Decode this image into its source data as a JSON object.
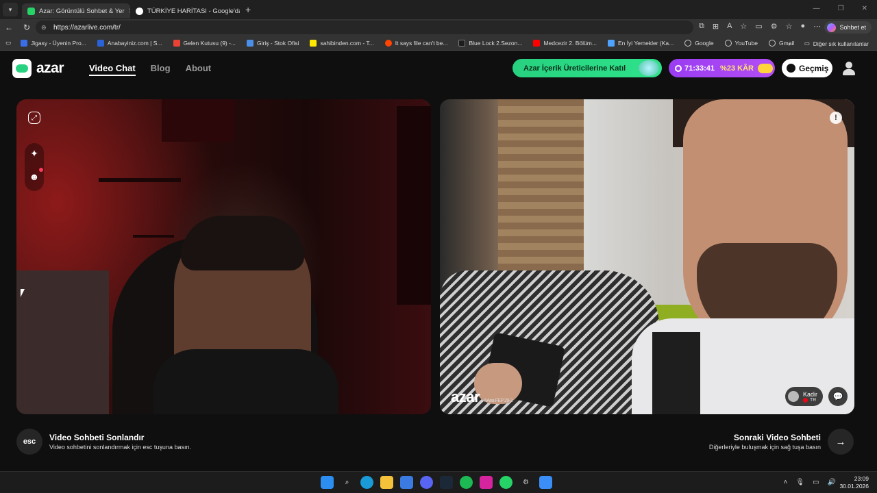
{
  "browser": {
    "tabs": [
      {
        "title": "Azar: Görüntülü Sohbet & Yer",
        "active": true
      },
      {
        "title": "TÜRKİYE HARİTASI - Google'da Ar",
        "active": false
      }
    ],
    "url": "https://azarlive.com/tr/",
    "sohbet_label": "Sohbet et",
    "bookmarks": [
      "Jigasy - Üyenin Pro...",
      "Anabayiniz.com | S...",
      "Gelen Kutusu (9) -...",
      "Giriş - Stok Ofisi",
      "sahibinden.com - T...",
      "It says file can't be...",
      "Blue Lock 2.Sezon...",
      "Medcezir 2. Bölüm...",
      "En İyi Yemekler (Ka...",
      "Google",
      "YouTube",
      "Gmail"
    ],
    "other_bookmarks": "Diğer sık kullanılanlar"
  },
  "site": {
    "logo": "azar",
    "nav": [
      "Video Chat",
      "Blog",
      "About"
    ],
    "creator_button": "Azar İçerik Üreticilerine Katıl",
    "timer": "71:33:41",
    "discount": "%23 KÂR",
    "history_button": "Geçmiş"
  },
  "remote": {
    "watermark": "azar",
    "watermark_id": "AAea FEP 29-2",
    "peer_name": "Kadir",
    "peer_country": "TR"
  },
  "footer": {
    "esc_key": "esc",
    "end_title": "Video Sohbeti Sonlandır",
    "end_sub": "Video sohbetini sonlandırmak için esc tuşuna basın.",
    "next_title": "Sonraki Video Sohbeti",
    "next_sub": "Diğerleriyle buluşmak için sağ tuşa basın"
  },
  "taskbar": {
    "time": "23:09",
    "date": "30.01.2026"
  },
  "colors": {
    "accent_green": "#27d17f",
    "accent_purple": "#a443f3",
    "background": "#0f0f0f"
  }
}
